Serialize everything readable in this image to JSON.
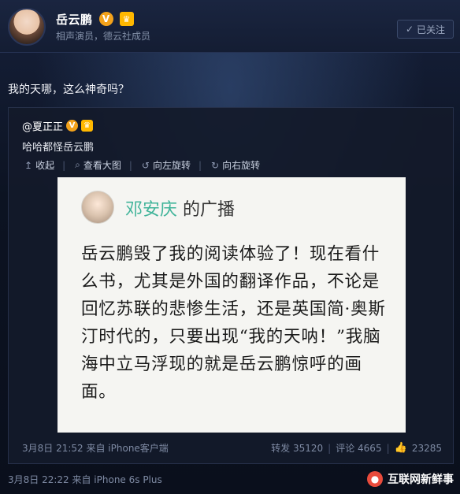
{
  "profile": {
    "name": "岳云鹏",
    "badge_v": "V",
    "subtitle": "相声演员，德云社成员",
    "follow_label": "已关注"
  },
  "post": {
    "text": "我的天哪，这么神奇吗？",
    "meta": "3月8日 22:22 来自 iPhone 6s Plus"
  },
  "repost": {
    "author": "@夏正正",
    "text": "哈哈都怪岳云鹏",
    "toolbar": [
      {
        "icon": "collapse-icon",
        "label": "收起"
      },
      {
        "icon": "zoom-icon",
        "label": "查看大图"
      },
      {
        "icon": "rotate-left-icon",
        "label": "向左旋转"
      },
      {
        "icon": "rotate-right-icon",
        "label": "向右旋转"
      }
    ],
    "image": {
      "name": "邓安庆",
      "suffix": "的广播",
      "body": "岳云鹏毁了我的阅读体验了！现在看什么书，尤其是外国的翻译作品，不论是回忆苏联的悲惨生活，还是英国简·奥斯汀时代的，只要出现“我的天呐！”我脑海中立马浮现的就是岳云鹏惊呼的画面。"
    },
    "meta": "3月8日 21:52 来自 iPhone客户端",
    "repost_count": "转发 35120",
    "comment_count": "评论 4665",
    "like_count": "23285"
  },
  "watermark": {
    "label": "互联网新鲜事"
  },
  "colors": {
    "accent_name": "#41b49a",
    "badge_v": "#f3a21b",
    "background": "#0f1626"
  }
}
